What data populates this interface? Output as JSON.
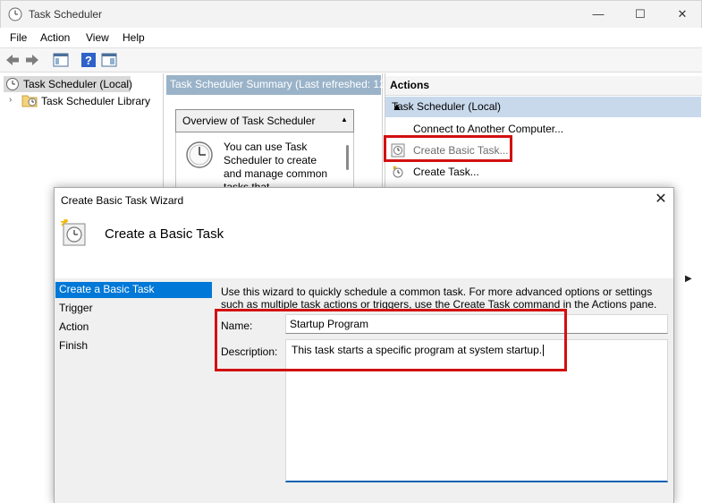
{
  "window": {
    "title": "Task Scheduler",
    "controls": {
      "minimize": "—",
      "maximize": "☐",
      "close": "✕"
    }
  },
  "menu": [
    "File",
    "Action",
    "View",
    "Help"
  ],
  "toolbar": {
    "icons": [
      "back-arrow-icon",
      "forward-arrow-icon",
      "show-hide-console-tree-icon",
      "help-icon",
      "show-hide-action-pane-icon"
    ]
  },
  "tree": {
    "root": "Task Scheduler (Local)",
    "library": "Task Scheduler Library"
  },
  "summary": {
    "header": "Task Scheduler Summary (Last refreshed: 12/",
    "overview_title": "Overview of Task Scheduler",
    "overview_text": "You can use Task Scheduler to create and manage common tasks that"
  },
  "actions": {
    "header": "Actions",
    "group": "Task Scheduler (Local)",
    "items": [
      "Connect to Another Computer...",
      "Create Basic Task...",
      "Create Task..."
    ]
  },
  "dialog": {
    "title": "Create Basic Task Wizard",
    "close": "✕",
    "heading": "Create a Basic Task",
    "steps": [
      "Create a Basic Task",
      "Trigger",
      "Action",
      "Finish"
    ],
    "active_step": 0,
    "instructions_line1": "Use this wizard to quickly schedule a common task.  For more advanced options or settings",
    "instructions_line2": "such as multiple task actions or triggers, use the Create Task command in the Actions pane.",
    "name_label": "Name:",
    "name_value": "Startup Program",
    "description_label": "Description:",
    "description_value": "This task starts a specific program at system startup."
  },
  "colors": {
    "highlight_box": "#d21010",
    "selected_step": "#0078d7",
    "summary_header": "#9ab3c9",
    "actions_group": "#c9d9ec"
  }
}
